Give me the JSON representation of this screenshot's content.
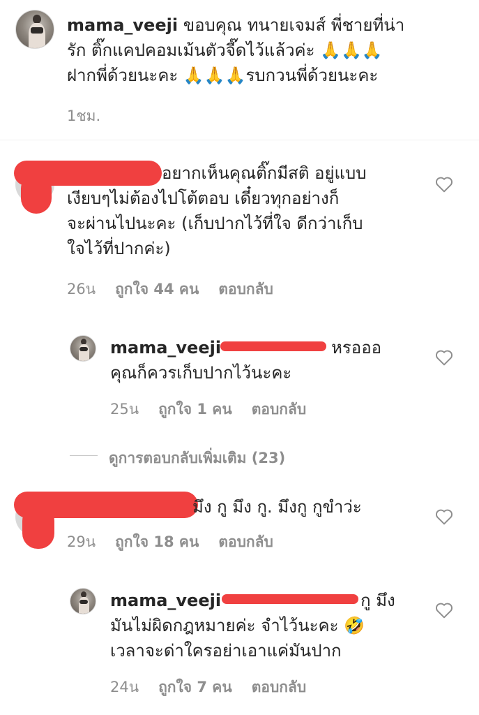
{
  "caption": {
    "username": "mama_veeji",
    "line1": " ขอบคุณ ทนายเจมส์  พี่ชายที่น่า",
    "line2": "รัก ติ๊กแคปคอมเม้นตัวจี๊ดไว้แล้วค่ะ 🙏🙏🙏",
    "line3": "ฝากพี่ด้วยนะคะ 🙏🙏🙏รบกวนพี่ด้วยนะคะ",
    "time": "1ชม."
  },
  "comment1": {
    "line1": "อยากเห็นคุณติ๊กมีสติ อยู่แบบ",
    "line2": "เงียบๆไม่ต้องไปโต้ตอบ เดี๋ยวทุกอย่างก็",
    "line3": "จะผ่านไปนะคะ (เก็บปากไว้ที่ใจ ดีกว่าเก็บ",
    "line4": "ใจไว้ที่ปากค่ะ)",
    "time": "26น",
    "likes": "ถูกใจ 44 คน",
    "reply": "ตอบกลับ"
  },
  "reply1": {
    "username": "mama_veeji",
    "mention_end": "หรอออ",
    "line2": "คุณก็ควรเก็บปากไว้นะคะ",
    "time": "25น",
    "likes": "ถูกใจ 1 คน",
    "reply": "ตอบกลับ"
  },
  "view_more": "ดูการตอบกลับเพิ่มเติม (23)",
  "comment2": {
    "line1": "มึง กู มึง กู. มึงกู  กูขำว่ะ",
    "time": "29น",
    "likes": "ถูกใจ 18 คน",
    "reply": "ตอบกลับ"
  },
  "reply2": {
    "username": "mama_veeji",
    "mention_end": "กู มึง",
    "line2": "มันไม่ผิดกฎหมายค่ะ จำไว้นะคะ 🤣",
    "line3": "เวลาจะด่าใครอย่าเอาแค่มันปาก",
    "time": "24น",
    "likes": "ถูกใจ 7 คน",
    "reply": "ตอบกลับ"
  },
  "colors": {
    "text": "#262626",
    "meta": "#8e8e8e",
    "redaction": "#f04040",
    "divider": "#efefef"
  },
  "icons": [
    "heart-icon",
    "avatar"
  ]
}
